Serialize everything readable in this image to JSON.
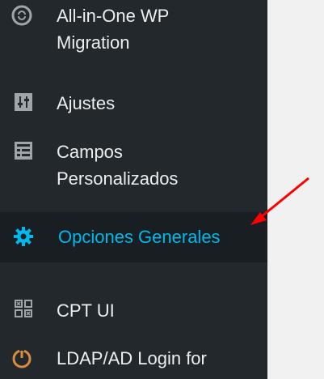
{
  "sidebar": {
    "items": [
      {
        "label_line1": "All-in-One WP",
        "label_line2": "Migration",
        "icon": "migration-refresh-icon"
      },
      {
        "label": "Ajustes",
        "icon": "settings-sliders-icon"
      },
      {
        "label_line1": "Campos",
        "label_line2": "Personalizados",
        "icon": "custom-fields-table-icon"
      },
      {
        "label": "Opciones Generales",
        "icon": "gear-icon",
        "active": true
      },
      {
        "label": "CPT UI",
        "icon": "cpt-grid-icon"
      },
      {
        "label": "LDAP/AD Login for",
        "icon": "ldap-power-icon"
      }
    ]
  },
  "colors": {
    "sidebar_bg": "#23282d",
    "active_bg": "#191e23",
    "active_text": "#00b9eb",
    "text": "#eeeeee",
    "arrow": "#ff0000",
    "content_bg": "#f1f1f1"
  }
}
